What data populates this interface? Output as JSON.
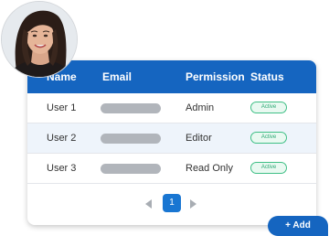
{
  "table": {
    "headers": {
      "name": "Name",
      "email": "Email",
      "permission": "Permission",
      "status": "Status"
    },
    "rows": [
      {
        "name": "User 1",
        "permission": "Admin",
        "status": "Active"
      },
      {
        "name": "User 2",
        "permission": "Editor",
        "status": "Active"
      },
      {
        "name": "User 3",
        "permission": "Read Only",
        "status": "Active"
      }
    ]
  },
  "pagination": {
    "current_page": "1"
  },
  "actions": {
    "add_label": "+ Add"
  },
  "colors": {
    "header_bg": "#1565c0",
    "row_alt_bg": "#eef4fb",
    "badge_green": "#2aa872",
    "email_placeholder": "#b1b5bb",
    "page_active": "#1976d2"
  }
}
